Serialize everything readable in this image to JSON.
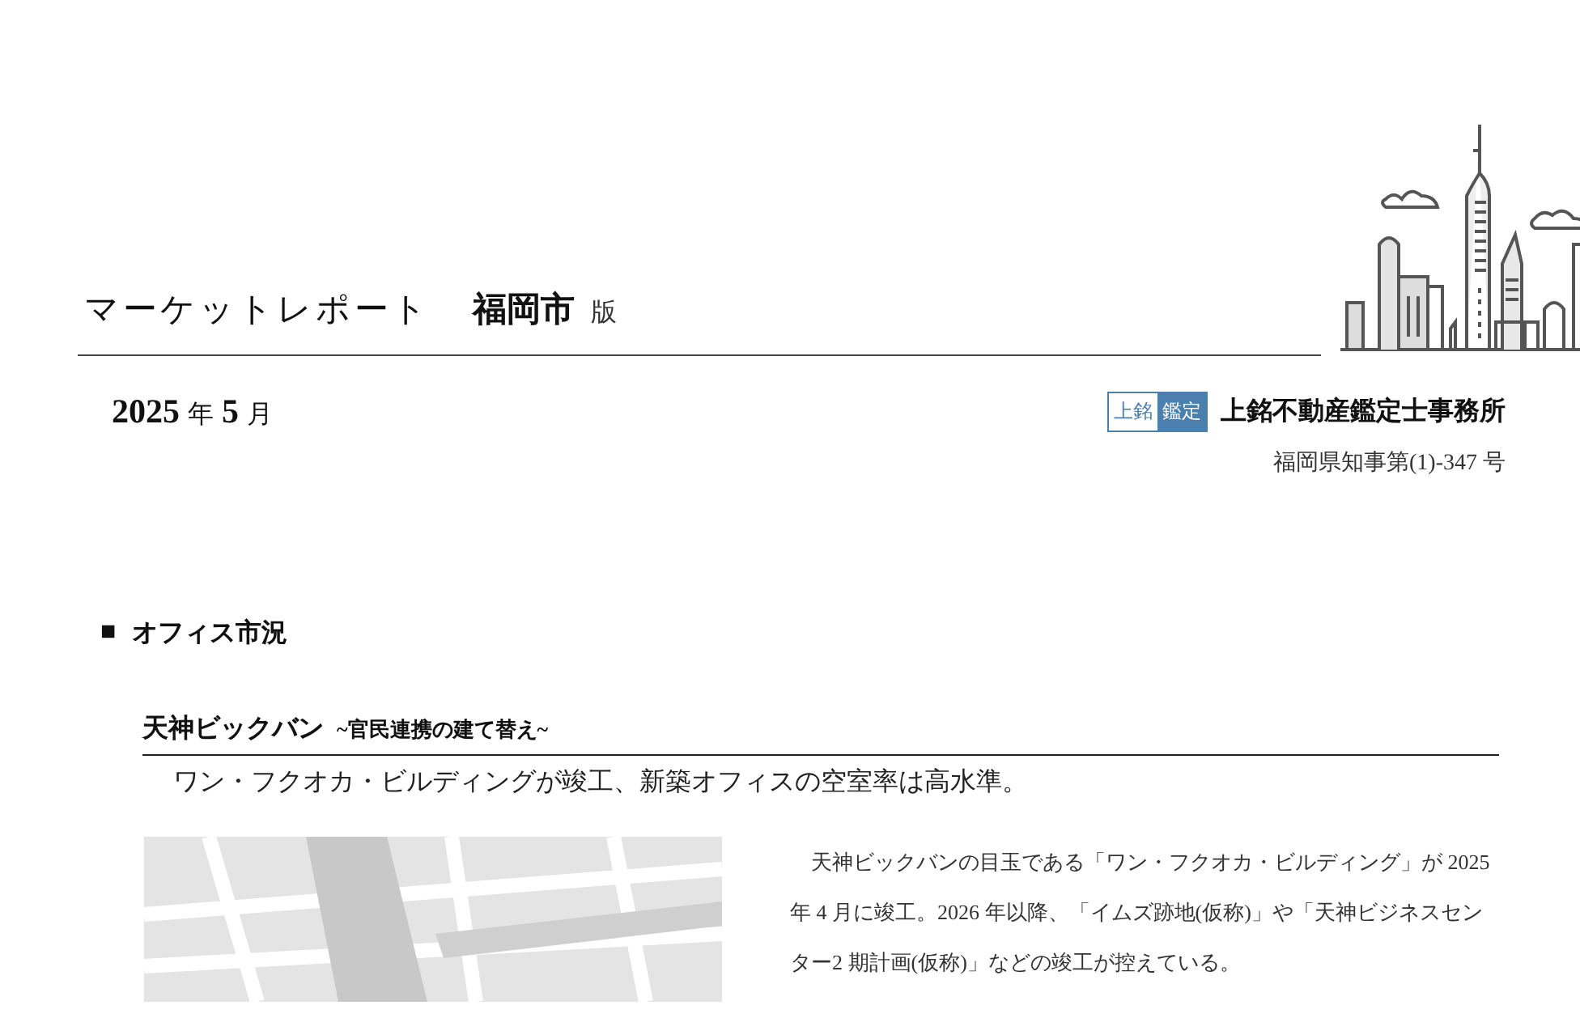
{
  "header": {
    "title": "マーケットレポート",
    "city": "福岡市",
    "edition": "版"
  },
  "date": {
    "year": "2025",
    "year_unit": "年",
    "month": "5",
    "month_unit": "月"
  },
  "issuer": {
    "logo": [
      "上銘",
      "鑑定"
    ],
    "name": "上銘不動産鑑定士事務所",
    "license": "福岡県知事第(1)-347 号"
  },
  "section": {
    "bullet": "■",
    "title": "オフィス市況"
  },
  "subsection": {
    "title": "天神ビックバン",
    "subtitle": "~官民連携の建て替え~",
    "lead": "ワン・フクオカ・ビルディングが竣工、新築オフィスの空室率は高水準。",
    "body": "天神ビックバンの目玉である「ワン・フクオカ・ビルディング」が 2025 年 4 月に竣工。2026 年以降、「イムズ跡地(仮称)」や「天神ビジネスセンター2 期計画(仮称)」などの竣工が控えている。"
  }
}
